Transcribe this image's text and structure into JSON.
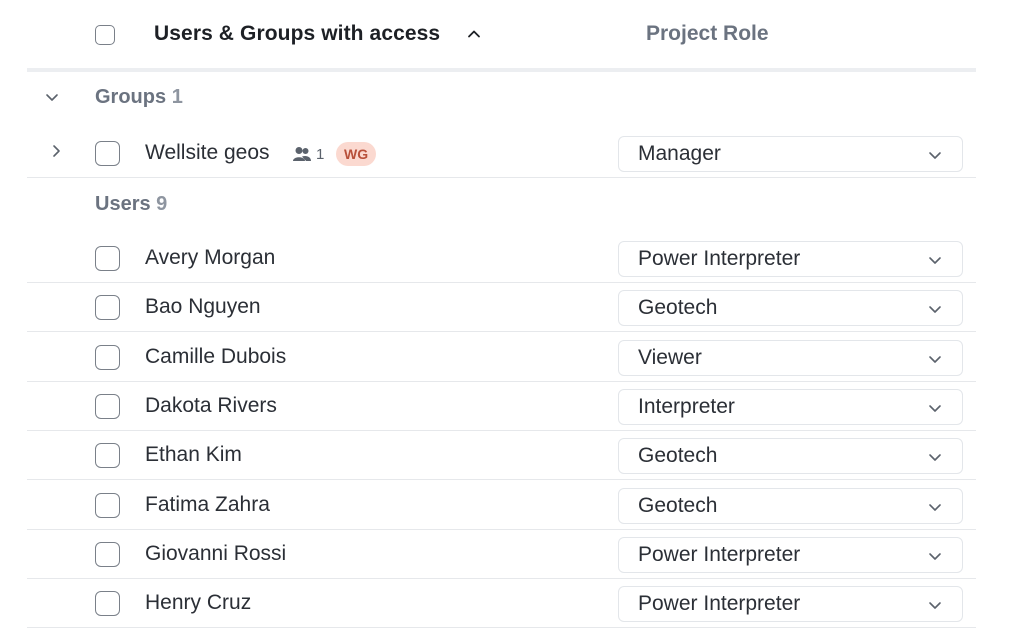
{
  "header": {
    "users_col": "Users & Groups with access",
    "role_col": "Project Role"
  },
  "groups_section": {
    "title": "Groups",
    "count": "1",
    "rows": [
      {
        "name": "Wellsite geos",
        "member_count": "1",
        "badge": "WG",
        "role": "Manager"
      }
    ]
  },
  "users_section": {
    "title": "Users",
    "count": "9",
    "rows": [
      {
        "name": "Avery Morgan",
        "role": "Power Interpreter"
      },
      {
        "name": "Bao Nguyen",
        "role": "Geotech"
      },
      {
        "name": "Camille Dubois",
        "role": "Viewer"
      },
      {
        "name": "Dakota Rivers",
        "role": "Interpreter"
      },
      {
        "name": "Ethan Kim",
        "role": "Geotech"
      },
      {
        "name": "Fatima Zahra",
        "role": "Geotech"
      },
      {
        "name": "Giovanni Rossi",
        "role": "Power Interpreter"
      },
      {
        "name": "Henry Cruz",
        "role": "Power Interpreter"
      }
    ]
  },
  "icons": {
    "sort": "chevron-up-icon",
    "collapse": "chevron-down-icon",
    "expand": "chevron-right-icon",
    "members": "users-icon",
    "dropdown": "chevron-down-icon"
  }
}
